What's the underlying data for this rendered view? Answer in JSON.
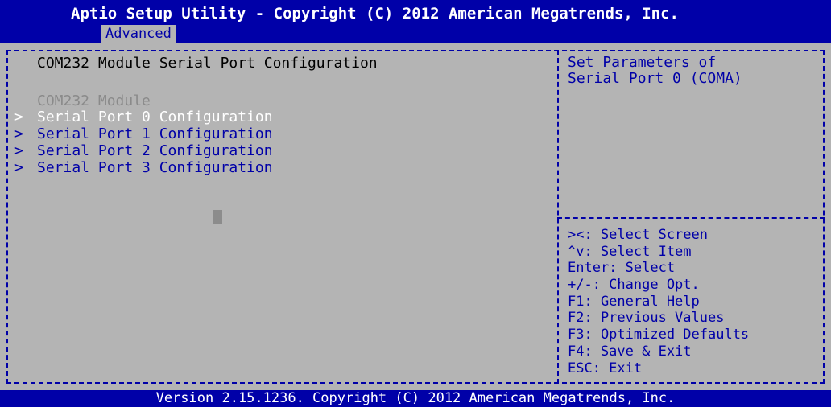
{
  "header": {
    "title": "Aptio Setup Utility - Copyright (C) 2012 American Megatrends, Inc.",
    "active_tab": "Advanced"
  },
  "main": {
    "page_title": "COM232 Module Serial Port Configuration",
    "section_label": "COM232 Module",
    "menu_items": [
      {
        "arrow": ">",
        "label": "Serial Port 0 Configuration",
        "selected": true
      },
      {
        "arrow": ">",
        "label": "Serial Port 1 Configuration",
        "selected": false
      },
      {
        "arrow": ">",
        "label": "Serial Port 2 Configuration",
        "selected": false
      },
      {
        "arrow": ">",
        "label": "Serial Port 3 Configuration",
        "selected": false
      }
    ]
  },
  "help": {
    "description_lines": [
      "Set Parameters of",
      "Serial Port 0 (COMA)"
    ],
    "keys": [
      "><: Select Screen",
      "^v: Select Item",
      "Enter: Select",
      "+/-: Change Opt.",
      "F1: General Help",
      "F2: Previous Values",
      "F3: Optimized Defaults",
      "F4: Save & Exit",
      "ESC: Exit"
    ]
  },
  "footer": {
    "version": "Version 2.15.1236. Copyright (C) 2012 American Megatrends, Inc."
  },
  "colors": {
    "header_bg": "#0000a8",
    "body_bg": "#b4b4b4",
    "text_blue": "#0000a8",
    "selected_text": "#ffffff"
  }
}
